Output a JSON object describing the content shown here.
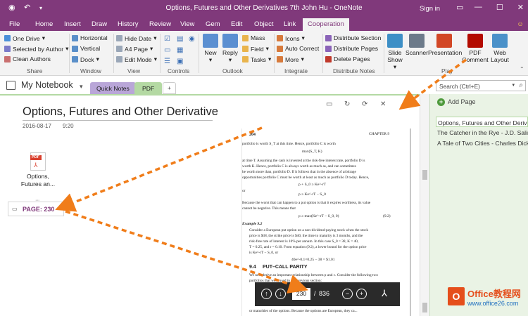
{
  "window": {
    "title": "Options, Futures and Other Derivatives 7th John Hu - OneNote",
    "sign_in": "Sign in",
    "min": "—",
    "max": "☐",
    "close": "✕"
  },
  "menu": [
    "File",
    "Home",
    "Insert",
    "Draw",
    "History",
    "Review",
    "View",
    "Gem",
    "Edit",
    "Object",
    "Link",
    "Cooperation"
  ],
  "ribbon": {
    "share": {
      "one_drive": "One Drive",
      "selected_by_author": "Selected by Author",
      "clean_authors": "Clean Authors",
      "label": "Share"
    },
    "window": {
      "horizontal": "Horizontal",
      "vertical": "Vertical",
      "dock": "Dock",
      "label": "Window"
    },
    "view": {
      "hide_date": "Hide Date",
      "a4_page": "A4 Page",
      "edit_mode": "Edit Mode",
      "label": "View"
    },
    "controls": {
      "label": "Controls"
    },
    "outlook": {
      "new": "New",
      "reply": "Reply",
      "mass": "Mass",
      "field": "Field",
      "tasks": "Tasks",
      "label": "Outlook"
    },
    "integrate": {
      "icons": "Icons",
      "auto_correct": "Auto Correct",
      "more": "More",
      "label": "Integrate"
    },
    "distribute": {
      "section": "Distribute Section",
      "pages": "Distribute Pages",
      "delete": "Delete Pages",
      "label": "Distribute Notes"
    },
    "play": {
      "slide_show": "Slide Show",
      "scanner": "Scanner",
      "presentation": "Presentation",
      "pdf_comment": "PDF Comment",
      "web_layout": "Web Layout",
      "label": "Play"
    }
  },
  "notebook": {
    "name": "My Notebook",
    "tabs": [
      "Quick Notes",
      "PDF"
    ],
    "add_tab": "+"
  },
  "search": {
    "placeholder": "Search (Ctrl+E)"
  },
  "page": {
    "title": "Options, Futures and Other Derivative",
    "date": "2016-08-17",
    "time": "9:20",
    "pdf_icon_text": "PDF",
    "attachment_name": "Options, Futures an...",
    "comment": "PAGE: 230"
  },
  "pdf": {
    "page_marker": "204",
    "chapter": "CHAPTER 9",
    "p1": "portfolio is worth S_T at this time. Hence, portfolio C is worth",
    "f1": "max(S_T, K)",
    "p2a": "at time T. Assuming the cash is invested at the risk-free interest rate, portfolio D is",
    "p2b": "worth K. Hence, portfolio C is always worth as much as, and can sometimes",
    "p2c": "be worth more than, portfolio D. If it follows that in the absence of arbitrage",
    "p2d": "opportunities portfolio C must be worth at least as much as portfolio D today. Hence,",
    "f2": "p + S_0 ≥ Ke^-rT",
    "or1": "or",
    "f3": "p ≥ Ke^-rT − S_0",
    "p3a": "Because the worst that can happen to a put option is that it expires worthless, its value",
    "p3b": "cannot be negative. This means that",
    "f4": "p ≥ max(Ke^-rT − S_0, 0)",
    "eqno": "(9.2)",
    "ex": "Example 9.2",
    "p4a": "Consider a European put option on a non-dividend-paying stock when the stock",
    "p4b": "price is $38, the strike price is $40, the time to maturity is 3 months, and the",
    "p4c": "risk-free rate of interest is 10% per annum. In this case S_0 = 38, K = 40,",
    "p4d": "T = 0.25, and r = 0.10. From equation (9.2), a lower bound for the option price",
    "p4e": "is Ke^-rT − S_0, or",
    "f5": "40e^-0.1×0.25 − 38 = $1.01",
    "sec_no": "9.4",
    "sec": "PUT–CALL PARITY",
    "p5a": "We now derive an important relationship between p and c. Consider the following two",
    "p5b": "portfolios that were used in the previous section:",
    "p6": "or maturities of the options. Because the options are European, they ca..."
  },
  "pdf_toolbar": {
    "current": "230",
    "slash": "/",
    "total": "836"
  },
  "pages": [
    "Options, Futures and Other Derivatives",
    "The Catcher in the Rye - J.D. Salinger",
    "A Tale of Two Cities - Charles Dickens"
  ],
  "add_page": "Add Page",
  "brand": {
    "name": "Office教程网",
    "url": "www.office26.com",
    "logo": "O"
  }
}
